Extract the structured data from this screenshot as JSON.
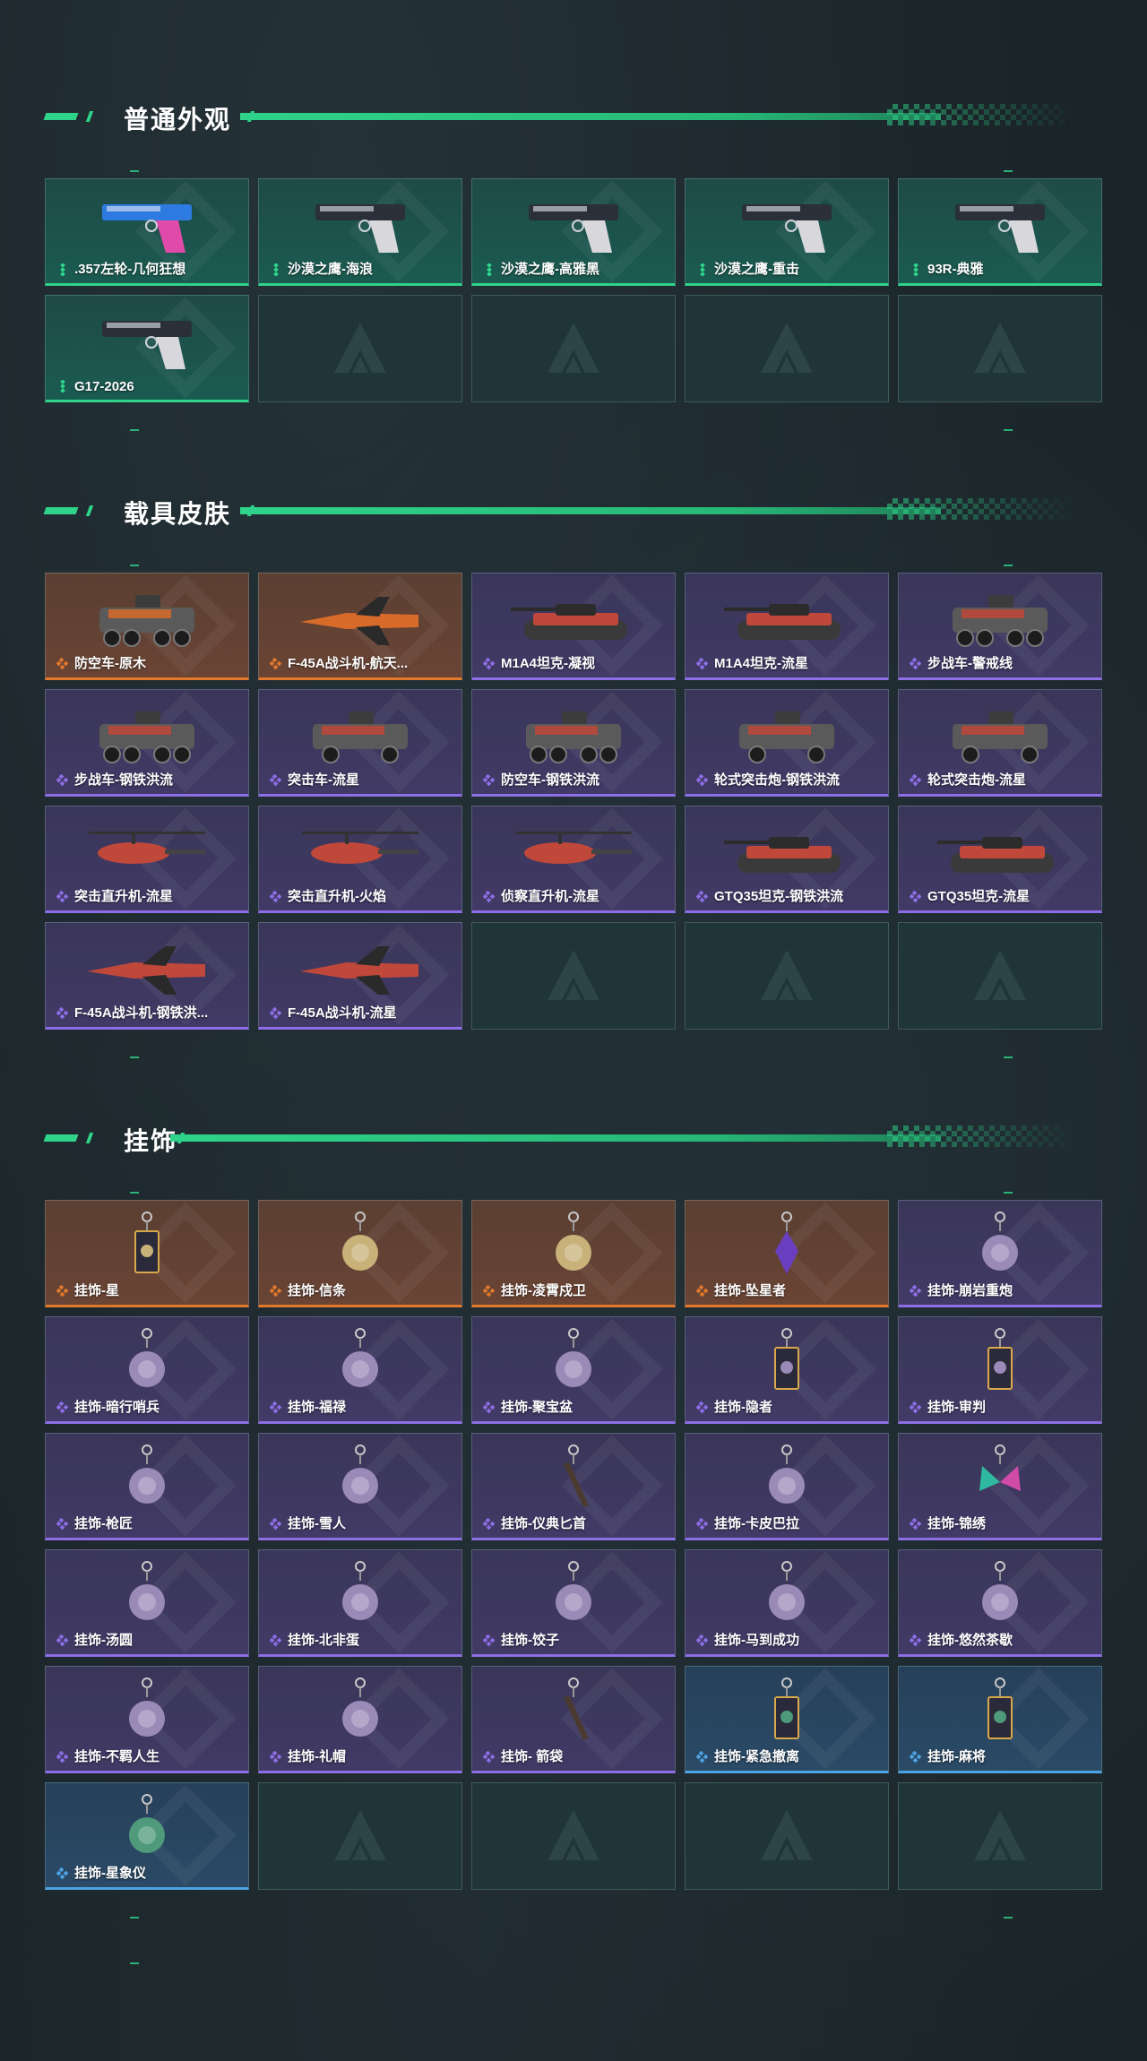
{
  "sections": [
    {
      "title": "普通外观",
      "items": [
        {
          "name": ".357左轮-几何狂想",
          "tier": "green",
          "icon": "revolver-icon"
        },
        {
          "name": "沙漠之鹰-海浪",
          "tier": "green",
          "icon": "pistol-icon"
        },
        {
          "name": "沙漠之鹰-高雅黑",
          "tier": "green",
          "icon": "pistol-icon"
        },
        {
          "name": "沙漠之鹰-重击",
          "tier": "green",
          "icon": "pistol-icon"
        },
        {
          "name": "93R-典雅",
          "tier": "green",
          "icon": "pistol-icon"
        },
        {
          "name": "G17-2026",
          "tier": "green",
          "icon": "pistol-icon"
        },
        {
          "empty": true
        },
        {
          "empty": true
        },
        {
          "empty": true
        },
        {
          "empty": true
        }
      ]
    },
    {
      "title": "载具皮肤",
      "items": [
        {
          "name": "防空车-原木",
          "tier": "orange",
          "icon": "armored-car-icon"
        },
        {
          "name": "F-45A战斗机-航天...",
          "tier": "orange",
          "icon": "jet-icon"
        },
        {
          "name": "M1A4坦克-凝视",
          "tier": "purple",
          "icon": "tank-icon"
        },
        {
          "name": "M1A4坦克-流星",
          "tier": "purple",
          "icon": "tank-icon"
        },
        {
          "name": "步战车-警戒线",
          "tier": "purple",
          "icon": "armored-car-icon"
        },
        {
          "name": "步战车-钢铁洪流",
          "tier": "purple",
          "icon": "armored-car-icon"
        },
        {
          "name": "突击车-流星",
          "tier": "purple",
          "icon": "assault-vehicle-icon"
        },
        {
          "name": "防空车-钢铁洪流",
          "tier": "purple",
          "icon": "armored-car-icon"
        },
        {
          "name": "轮式突击炮-钢铁洪流",
          "tier": "purple",
          "icon": "assault-vehicle-icon"
        },
        {
          "name": "轮式突击炮-流星",
          "tier": "purple",
          "icon": "assault-vehicle-icon"
        },
        {
          "name": "突击直升机-流星",
          "tier": "purple",
          "icon": "helicopter-icon"
        },
        {
          "name": "突击直升机-火焰",
          "tier": "purple",
          "icon": "helicopter-icon"
        },
        {
          "name": "侦察直升机-流星",
          "tier": "purple",
          "icon": "helicopter-icon"
        },
        {
          "name": "GTQ35坦克-钢铁洪流",
          "tier": "purple",
          "icon": "tank-icon"
        },
        {
          "name": "GTQ35坦克-流星",
          "tier": "purple",
          "icon": "tank-icon"
        },
        {
          "name": "F-45A战斗机-钢铁洪...",
          "tier": "purple",
          "icon": "jet-icon"
        },
        {
          "name": "F-45A战斗机-流星",
          "tier": "purple",
          "icon": "jet-icon"
        },
        {
          "empty": true
        },
        {
          "empty": true
        },
        {
          "empty": true
        }
      ]
    },
    {
      "title": "挂饰",
      "items": [
        {
          "name": "挂饰-星",
          "tier": "orange",
          "icon": "charm-card-icon"
        },
        {
          "name": "挂饰-信条",
          "tier": "orange",
          "icon": "charm-icon"
        },
        {
          "name": "挂饰-凌霄戍卫",
          "tier": "orange",
          "icon": "charm-icon"
        },
        {
          "name": "挂饰-坠星者",
          "tier": "orange",
          "icon": "charm-crystal-icon"
        },
        {
          "name": "挂饰-崩岩重炮",
          "tier": "purple",
          "icon": "charm-icon"
        },
        {
          "name": "挂饰-暗行哨兵",
          "tier": "purple",
          "icon": "charm-icon"
        },
        {
          "name": "挂饰-福禄",
          "tier": "purple",
          "icon": "charm-icon"
        },
        {
          "name": "挂饰-聚宝盆",
          "tier": "purple",
          "icon": "charm-icon"
        },
        {
          "name": "挂饰-隐者",
          "tier": "purple",
          "icon": "charm-card-icon"
        },
        {
          "name": "挂饰-审判",
          "tier": "purple",
          "icon": "charm-card-icon"
        },
        {
          "name": "挂饰-枪匠",
          "tier": "purple",
          "icon": "charm-icon"
        },
        {
          "name": "挂饰-雪人",
          "tier": "purple",
          "icon": "charm-icon"
        },
        {
          "name": "挂饰-仪典匕首",
          "tier": "purple",
          "icon": "charm-knife-icon"
        },
        {
          "name": "挂饰-卡皮巴拉",
          "tier": "purple",
          "icon": "charm-icon"
        },
        {
          "name": "挂饰-锦绣",
          "tier": "purple",
          "icon": "charm-butterfly-icon"
        },
        {
          "name": "挂饰-汤圆",
          "tier": "purple",
          "icon": "charm-icon"
        },
        {
          "name": "挂饰-北非蛋",
          "tier": "purple",
          "icon": "charm-icon"
        },
        {
          "name": "挂饰-饺子",
          "tier": "purple",
          "icon": "charm-icon"
        },
        {
          "name": "挂饰-马到成功",
          "tier": "purple",
          "icon": "charm-icon"
        },
        {
          "name": "挂饰-悠然茶歇",
          "tier": "purple",
          "icon": "charm-icon"
        },
        {
          "name": "挂饰-不羁人生",
          "tier": "purple",
          "icon": "charm-icon"
        },
        {
          "name": "挂饰-礼帽",
          "tier": "purple",
          "icon": "charm-icon"
        },
        {
          "name": "挂饰- 箭袋",
          "tier": "purple",
          "icon": "charm-knife-icon"
        },
        {
          "name": "挂饰-紧急撤离",
          "tier": "blue",
          "icon": "charm-card-icon"
        },
        {
          "name": "挂饰-麻将",
          "tier": "blue",
          "icon": "charm-card-icon"
        },
        {
          "name": "挂饰-星象仪",
          "tier": "blue",
          "icon": "charm-icon"
        },
        {
          "empty": true
        },
        {
          "empty": true
        },
        {
          "empty": true
        },
        {
          "empty": true
        }
      ]
    }
  ],
  "colors": {
    "accent": "#2fd38a",
    "tier_green": "#2fd38a",
    "tier_orange": "#e1782c",
    "tier_purple": "#8d6ee6",
    "tier_blue": "#4da3e3"
  }
}
